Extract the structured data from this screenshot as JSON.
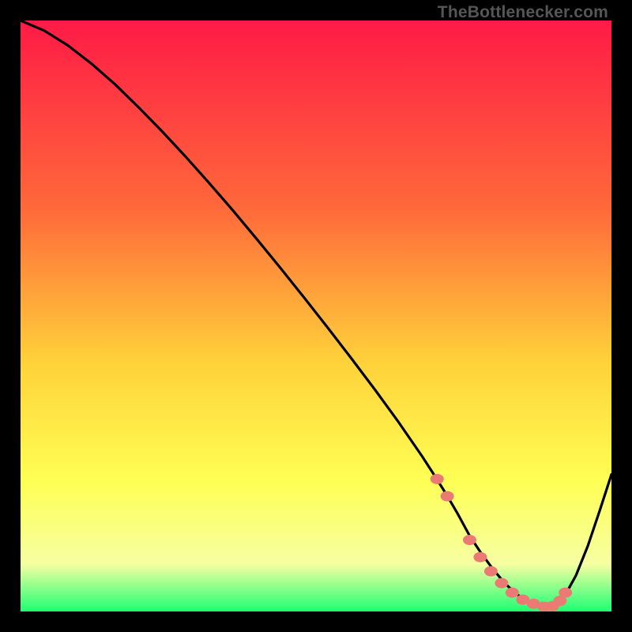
{
  "attribution": "TheBottlenecker.com",
  "colors": {
    "frame": "#000000",
    "curve": "#000000",
    "markers": "#eb7a75",
    "gradient_top": "#ff1a46",
    "gradient_mid1": "#ff6a3a",
    "gradient_mid2": "#ffd23a",
    "gradient_mid3": "#ffff55",
    "gradient_mid4": "#f6ffa2",
    "gradient_bottom": "#1dff73"
  },
  "chart_data": {
    "type": "line",
    "title": "",
    "xlabel": "",
    "ylabel": "",
    "xlim": [
      0,
      100
    ],
    "ylim": [
      0,
      100
    ],
    "series": [
      {
        "name": "bottleneck-curve",
        "x": [
          0,
          4,
          8,
          12,
          16,
          20,
          24,
          28,
          32,
          36,
          40,
          44,
          48,
          52,
          56,
          60,
          64,
          68,
          70,
          72,
          74,
          76,
          78,
          80,
          82,
          84,
          86,
          88,
          90,
          92,
          94,
          96,
          98,
          100
        ],
        "y": [
          100,
          98.3,
          95.8,
          92.7,
          89.2,
          85.3,
          81.2,
          76.9,
          72.4,
          67.8,
          63.0,
          58.1,
          53.1,
          48.0,
          42.8,
          37.5,
          32.0,
          26.2,
          23.1,
          19.9,
          16.5,
          12.8,
          9.8,
          7.1,
          4.7,
          2.9,
          1.6,
          0.8,
          0.9,
          2.5,
          6.1,
          11.1,
          17.0,
          23.2
        ]
      }
    ],
    "markers": {
      "name": "highlighted-points",
      "x": [
        70.5,
        72.2,
        76.0,
        77.8,
        79.6,
        81.4,
        83.2,
        85.0,
        86.8,
        88.6,
        90.0,
        91.3,
        92.2
      ],
      "y": [
        22.4,
        19.5,
        12.1,
        9.2,
        6.8,
        4.8,
        3.2,
        2.0,
        1.3,
        0.8,
        0.9,
        1.8,
        3.2
      ]
    }
  }
}
